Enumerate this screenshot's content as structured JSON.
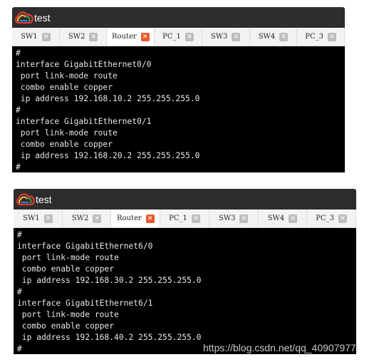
{
  "windows": [
    {
      "title": "test",
      "tabs": [
        {
          "label": "SW1"
        },
        {
          "label": "SW2"
        },
        {
          "label": "Router",
          "active": true
        },
        {
          "label": "PC_1"
        },
        {
          "label": "SW3"
        },
        {
          "label": "SW4"
        },
        {
          "label": "PC_3"
        }
      ],
      "terminal_lines": [
        "#",
        "interface GigabitEthernet0/0",
        " port link-mode route",
        " combo enable copper",
        " ip address 192.168.10.2 255.255.255.0",
        "#",
        "interface GigabitEthernet0/1",
        " port link-mode route",
        " combo enable copper",
        " ip address 192.168.20.2 255.255.255.0",
        "#"
      ]
    },
    {
      "title": "test",
      "tabs": [
        {
          "label": "SW1"
        },
        {
          "label": "SW2"
        },
        {
          "label": "Router",
          "active": true
        },
        {
          "label": "PC_1"
        },
        {
          "label": "SW3"
        },
        {
          "label": "SW4"
        },
        {
          "label": "PC_3"
        }
      ],
      "terminal_lines": [
        "#",
        "interface GigabitEthernet6/0",
        " port link-mode route",
        " combo enable copper",
        " ip address 192.168.30.2 255.255.255.0",
        "#",
        "interface GigabitEthernet6/1",
        " port link-mode route",
        " combo enable copper",
        " ip address 192.168.40.2 255.255.255.0",
        "#"
      ]
    }
  ],
  "close_glyph": "✕",
  "watermark": "https://blog.csdn.net/qq_40907977",
  "colors": {
    "titlebar": "#2d2d2d",
    "terminal_bg": "#000000",
    "active_close": "#e85a2c"
  }
}
